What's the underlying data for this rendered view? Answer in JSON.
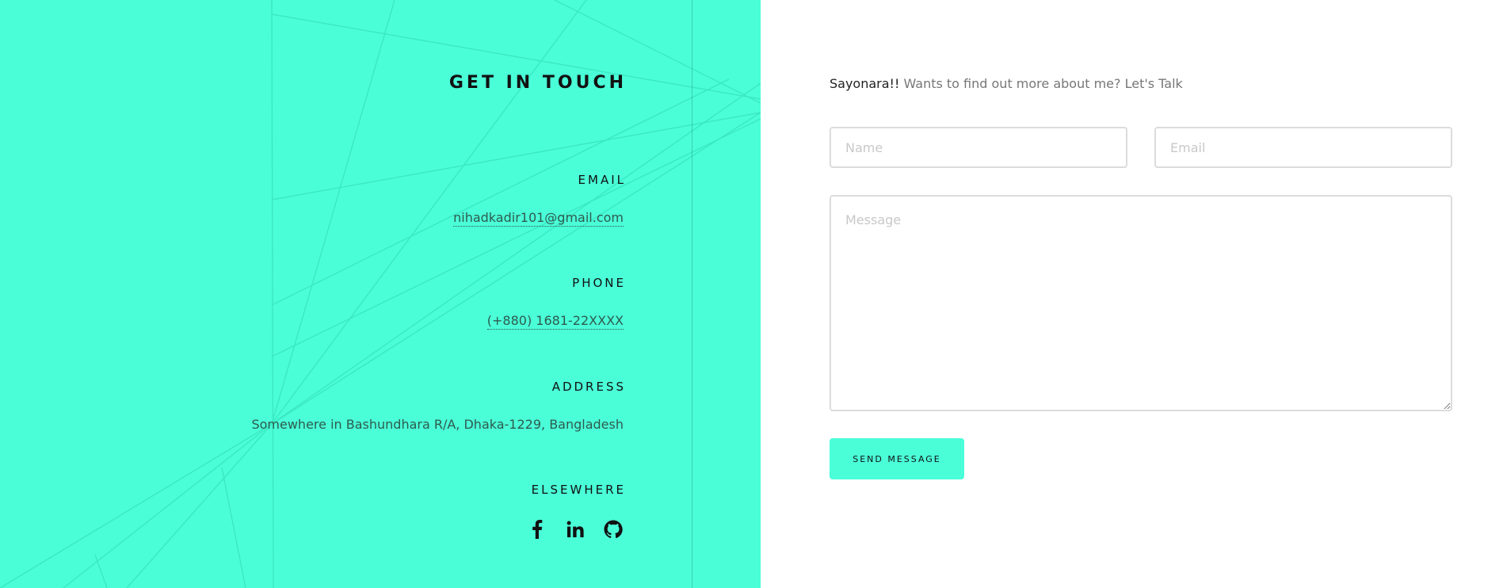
{
  "colors": {
    "accent": "#4afed8",
    "text_dark": "#111111",
    "text_muted": "#777777",
    "border": "#dcdcdc"
  },
  "contact": {
    "title": "GET IN TOUCH",
    "email_label": "EMAIL",
    "email_value": "nihadkadir101@gmail.com",
    "phone_label": "PHONE",
    "phone_value": "(+880) 1681-22XXXX",
    "address_label": "ADDRESS",
    "address_value": "Somewhere in Bashundhara R/A, Dhaka-1229, Bangladesh",
    "elsewhere_label": "ELSEWHERE",
    "socials": [
      {
        "icon": "facebook-icon"
      },
      {
        "icon": "linkedin-icon"
      },
      {
        "icon": "github-icon"
      }
    ]
  },
  "form": {
    "intro_bold": "Sayonara!!",
    "intro_text": " Wants to find out more about me? Let's Talk",
    "name_placeholder": "Name",
    "name_value": "",
    "email_placeholder": "Email",
    "email_value": "",
    "message_placeholder": "Message",
    "message_value": "",
    "submit_label": "SEND MESSAGE"
  }
}
